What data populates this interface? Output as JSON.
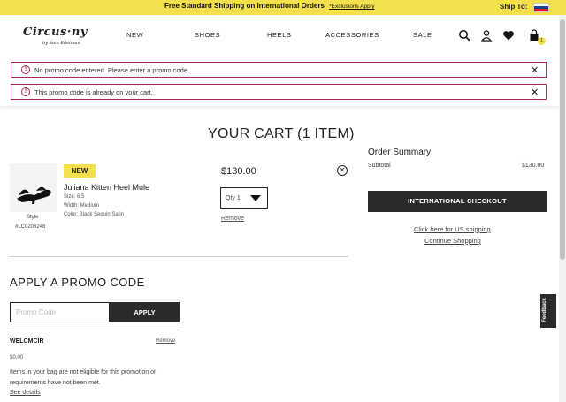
{
  "topbar": {
    "promo": "Free Standard Shipping on International Orders",
    "exclusions": "*Exclusions Apply",
    "ship_to": "Ship To:",
    "flag_colors": [
      "#ffffff",
      "#1c3f94",
      "#e4181c"
    ]
  },
  "header": {
    "logo": "Circus·ny",
    "logo_sub": "by Sam Edelman",
    "nav": [
      "NEW",
      "SHOES",
      "HEELS",
      "ACCESSORIES",
      "SALE"
    ],
    "icons": [
      "search-icon",
      "account-icon",
      "wishlist-icon",
      "bag-icon"
    ],
    "bag_count": "1"
  },
  "errors": [
    {
      "message": "No promo code entered. Please enter a promo code."
    },
    {
      "message": "This promo code is already on your cart."
    }
  ],
  "cart": {
    "title": "YOUR CART (1 ITEM)",
    "item": {
      "badge": "NEW",
      "name": "Juliana Kitten Heel Mule",
      "size": "Size: 6.5",
      "width": "Width: Medium",
      "color": "Color: Black Sequin Satin",
      "style_label": "Style",
      "style_number": "#LC0206248",
      "price": "$130.00",
      "qty": "Qty 1",
      "remove": "Remove"
    }
  },
  "summary": {
    "title": "Order Summary",
    "subtotal_label": "Subtotal",
    "subtotal_value": "$130.00",
    "checkout": "INTERNATIONAL CHECKOUT",
    "us_shipping": "Click here for US shipping",
    "continue": "Continue Shopping"
  },
  "promo": {
    "title": "APPLY A PROMO CODE",
    "placeholder": "Promo Code",
    "apply": "APPLY",
    "code": "WELCMCIR",
    "remove": "Remove",
    "amount": "$0.00",
    "note": "Items in your bag are not eligible for this promotion or requirements have not been met.",
    "see_details": "See details"
  },
  "feedback": "Feedback",
  "colors": {
    "accent_yellow": "#f4e04d",
    "error": "#b0294f",
    "dark_button": "#2a2a2a"
  }
}
